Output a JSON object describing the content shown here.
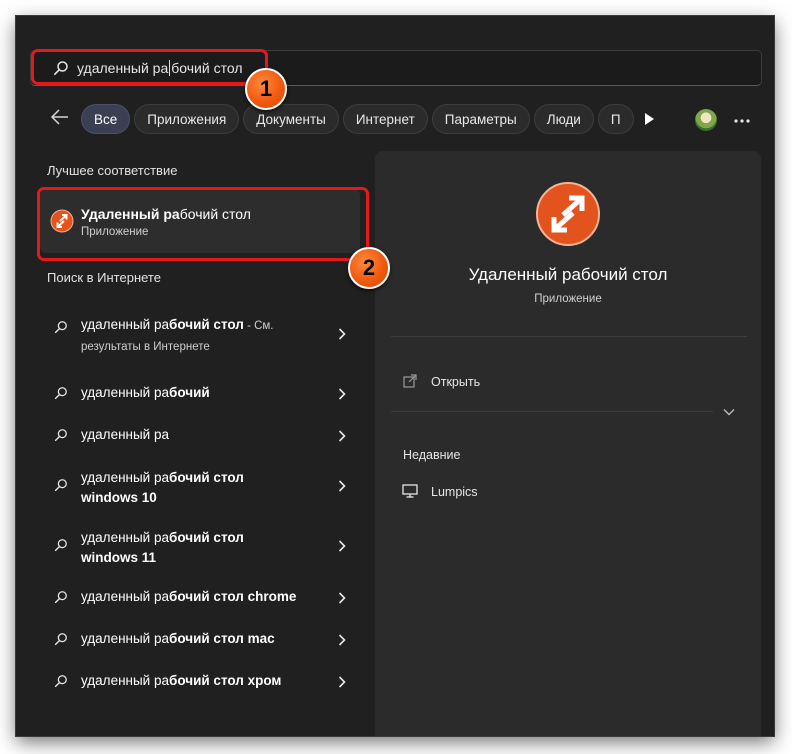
{
  "search": {
    "query_before_caret": "удаленный ра",
    "query_after_caret": "бочий стол",
    "icon": "search-icon"
  },
  "filters": {
    "back_icon": "back-arrow-icon",
    "chips": [
      "Все",
      "Приложения",
      "Документы",
      "Интернет",
      "Параметры",
      "Люди",
      "П"
    ],
    "active": "Все",
    "play_icon": "play-icon",
    "more_icon": "more-icon",
    "avatar_icon": "avatar-icon"
  },
  "best_match": {
    "heading": "Лучшее соответствие",
    "title_bold": "Удаленный ра",
    "title_rest": "бочий стол",
    "subtitle": "Приложение",
    "icon": "remote-desktop-icon"
  },
  "web": {
    "heading": "Поиск в Интернете",
    "items": [
      {
        "prefix": "удаленный ра",
        "bold": "бочий стол",
        "suffix": " - См.",
        "line2": "результаты в Интернете"
      },
      {
        "prefix": "удаленный ра",
        "bold": "бочий",
        "suffix": "",
        "line2": ""
      },
      {
        "prefix": "удаленный ра",
        "bold": "",
        "suffix": "",
        "line2": ""
      },
      {
        "prefix": "удаленный ра",
        "bold": "бочий стол",
        "suffix": "",
        "line2": "windows 10"
      },
      {
        "prefix": "удаленный ра",
        "bold": "бочий стол",
        "suffix": "",
        "line2": "windows 11"
      },
      {
        "prefix": "удаленный ра",
        "bold": "бочий стол chrome",
        "suffix": "",
        "line2": ""
      },
      {
        "prefix": "удаленный ра",
        "bold": "бочий стол mac",
        "suffix": "",
        "line2": ""
      },
      {
        "prefix": "удаленный ра",
        "bold": "бочий стол хром",
        "suffix": "",
        "line2": ""
      }
    ]
  },
  "details": {
    "title": "Удаленный рабочий стол",
    "subtitle": "Приложение",
    "open_label": "Открыть",
    "recent_heading": "Недавние",
    "recent_items": [
      "Lumpics"
    ]
  },
  "callouts": [
    "1",
    "2"
  ],
  "colors": {
    "callout_red": "#e3191e",
    "callout_orange": "#f15a0f",
    "rdp_orange": "#e2531d",
    "active_chip": "#3a3f52"
  }
}
